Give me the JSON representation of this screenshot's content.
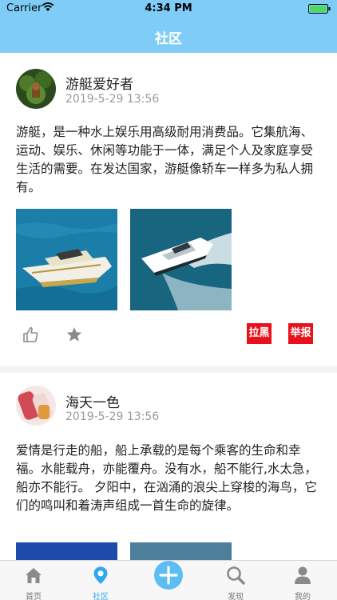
{
  "status_bar": {
    "carrier": "Carrier",
    "time": "4:34 PM"
  },
  "nav": {
    "title": "社区"
  },
  "posts": [
    {
      "username": "游艇爱好者",
      "time": "2019-5-29 13:56",
      "content": "游艇，是一种水上娱乐用高级耐用消费品。它集航海、运动、娱乐、休闲等功能于一体，满足个人及家庭享受生活的需要。在发达国家，游艇像轿车一样多为私人拥有。",
      "block_label": "拉黑",
      "report_label": "举报"
    },
    {
      "username": "海天一色",
      "time": "2019-5-29 13:56",
      "content": "爱情是行走的船，船上承载的是每个乘客的生命和幸福。水能载舟，亦能覆舟。没有水，船不能行,水太急，船亦不能行。 夕阳中，在汹涌的浪尖上穿梭的海鸟，它们的鸣叫和着涛声组成一首生命的旋律。"
    }
  ],
  "tabs": [
    {
      "label": "首页",
      "icon": "home-icon"
    },
    {
      "label": "社区",
      "icon": "location-pin-icon",
      "active": true
    },
    {
      "label": "",
      "icon": "plus-icon"
    },
    {
      "label": "发现",
      "icon": "search-icon"
    },
    {
      "label": "我的",
      "icon": "person-icon"
    }
  ],
  "colors": {
    "nav": "#7fcdf7",
    "accent": "#31a8ee",
    "report_red": "#e8111b"
  }
}
